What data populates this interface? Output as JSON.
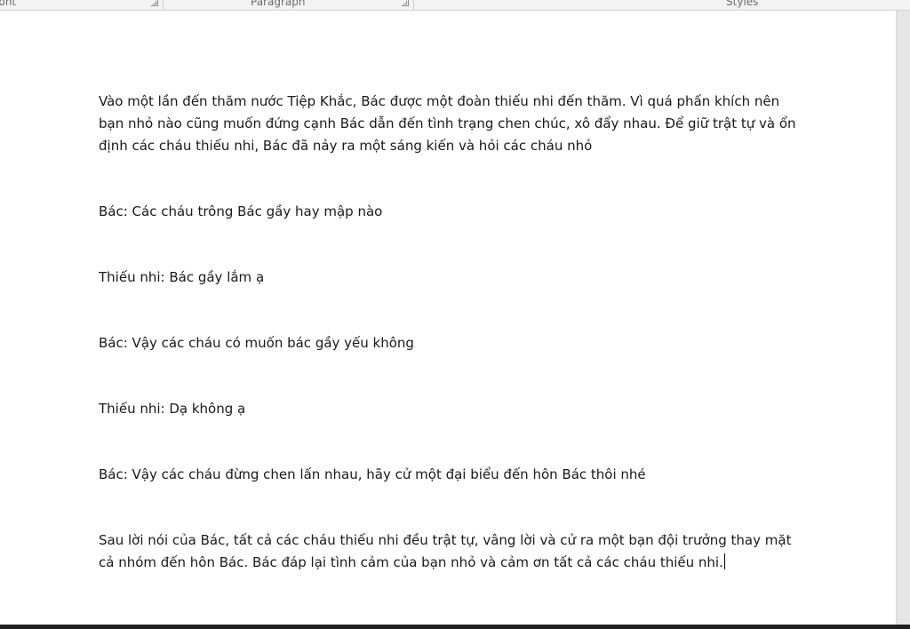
{
  "ribbon": {
    "groups": [
      {
        "label": "Font"
      },
      {
        "label": "Paragraph"
      },
      {
        "label": "Styles"
      }
    ]
  },
  "document": {
    "paragraphs": [
      "Vào một lần đến thăm nước Tiệp Khắc, Bác được một đoàn thiếu nhi đến thăm. Vì quá phấn khích nên bạn nhỏ nào cũng muốn đứng cạnh Bác dẫn đến tình trạng chen chúc, xô đẩy nhau. Để giữ trật tự và ổn định các cháu thiếu nhi, Bác đã nảy ra một sáng kiến và hỏi các cháu nhỏ",
      "Bác: Các cháu trông Bác gầy hay mập nào",
      "Thiếu nhi: Bác gầy lắm ạ",
      "Bác: Vậy các cháu có muốn bác gầy yếu không",
      "Thiếu nhi: Dạ không ạ",
      "Bác: Vậy các cháu đừng chen lấn nhau, hãy cử một đại biểu đến hôn Bác thôi nhé",
      "Sau lời nói của Bác, tất cả các cháu thiếu nhi đều trật tự, vâng lời và cử ra một bạn đội trưởng thay mặt cả nhóm đến hôn Bác. Bác đáp lại tình cảm của bạn nhỏ và cảm ơn tất cả các cháu thiếu nhi."
    ]
  }
}
